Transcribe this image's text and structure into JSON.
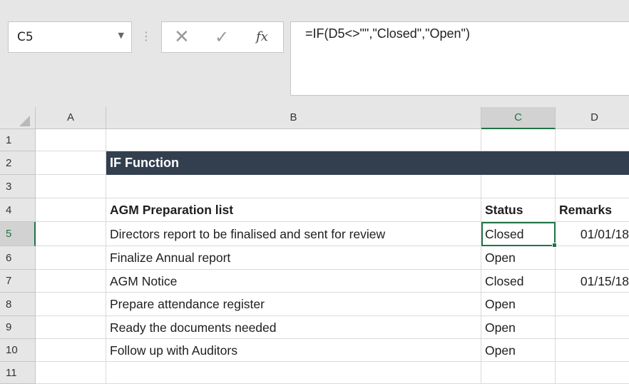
{
  "name_box": {
    "value": "C5"
  },
  "formula_bar": {
    "formula": "=IF(D5<>\"\",\"Closed\",\"Open\")",
    "fx_label": "fx"
  },
  "columns": [
    "A",
    "B",
    "C",
    "D"
  ],
  "selected_column": "C",
  "rows": [
    {
      "num": "1",
      "B": "",
      "C": "",
      "D": ""
    },
    {
      "num": "2",
      "B": "IF Function",
      "C": "",
      "D": ""
    },
    {
      "num": "3",
      "B": "",
      "C": "",
      "D": ""
    },
    {
      "num": "4",
      "B": "AGM Preparation list",
      "C": "Status",
      "D": "Remarks"
    },
    {
      "num": "5",
      "B": "Directors report to be finalised and sent for review",
      "C": "Closed",
      "D": "01/01/18"
    },
    {
      "num": "6",
      "B": "Finalize Annual report",
      "C": "Open",
      "D": ""
    },
    {
      "num": "7",
      "B": "AGM Notice",
      "C": "Closed",
      "D": "01/15/18"
    },
    {
      "num": "8",
      "B": "Prepare attendance register",
      "C": "Open",
      "D": ""
    },
    {
      "num": "9",
      "B": "Ready the documents needed",
      "C": "Open",
      "D": ""
    },
    {
      "num": "10",
      "B": "Follow up with Auditors",
      "C": "Open",
      "D": ""
    },
    {
      "num": "11",
      "B": "",
      "C": "",
      "D": ""
    }
  ],
  "colors": {
    "accent": "#217346",
    "banner": "#333f4f"
  }
}
